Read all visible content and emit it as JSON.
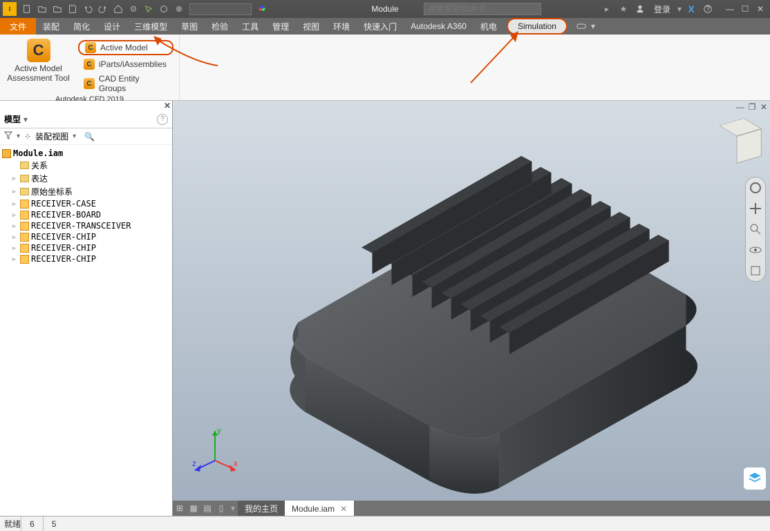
{
  "title": "Module",
  "search_placeholder": "搜索帮助和命令...",
  "login_label": "登录",
  "menus": [
    "文件",
    "装配",
    "简化",
    "设计",
    "三维模型",
    "草图",
    "检验",
    "工具",
    "管理",
    "视图",
    "环境",
    "快速入门",
    "Autodesk A360",
    "机电",
    "Simulation"
  ],
  "ribbon": {
    "big_label1": "Active Model",
    "big_label2": "Assessment Tool",
    "items": [
      "Active Model",
      "iParts/iAssemblies",
      "CAD Entity Groups"
    ],
    "group": "Autodesk CFD 2019"
  },
  "browser": {
    "header": "模型",
    "toolbar_label": "装配视图",
    "root": "Module.iam",
    "nodes": [
      {
        "label": "关系",
        "type": "folder",
        "exp": ""
      },
      {
        "label": "表达",
        "type": "folder",
        "exp": "▹"
      },
      {
        "label": "原始坐标系",
        "type": "folder",
        "exp": "▹"
      },
      {
        "label": "RECEIVER-CASE",
        "type": "part",
        "exp": "▹"
      },
      {
        "label": "RECEIVER-BOARD",
        "type": "part",
        "exp": "▹"
      },
      {
        "label": "RECEIVER-TRANSCEIVER",
        "type": "part",
        "exp": "▹"
      },
      {
        "label": "RECEIVER-CHIP",
        "type": "part",
        "exp": "▹"
      },
      {
        "label": "RECEIVER-CHIP",
        "type": "part",
        "exp": "▹"
      },
      {
        "label": "RECEIVER-CHIP",
        "type": "part",
        "exp": "▹"
      }
    ]
  },
  "tabs": {
    "home": "我的主页",
    "active": "Module.iam"
  },
  "status": {
    "text": "就绪",
    "n1": "6",
    "n2": "5"
  },
  "triad": {
    "x": "x",
    "y": "y",
    "z": "z"
  }
}
